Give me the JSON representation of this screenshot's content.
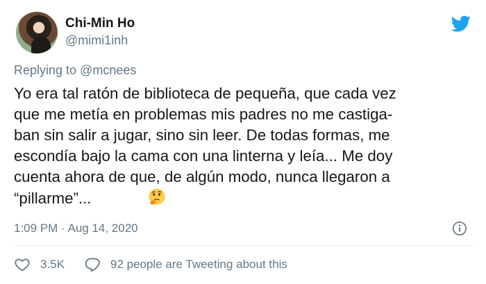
{
  "author": {
    "display_name": "Chi-Min Ho",
    "handle": "@mimi1inh"
  },
  "reply_context": {
    "prefix": "Replying to ",
    "mention": "@mcnees"
  },
  "tweet": {
    "lines": [
      "Yo era tal ratón de biblioteca de pequeña, que cada vez",
      "que me metía en problemas mis padres no me castiga-",
      "ban sin salir a jugar, sino sin leer. De todas formas, me",
      "escondía bajo la cama con una linterna y leía... Me doy",
      "cuenta ahora de que, de algún modo, nunca llegaron a",
      "“pillarme”..."
    ],
    "emoji": "thinking-face-icon"
  },
  "meta": {
    "timestamp": "1:09 PM · Aug 14, 2020"
  },
  "actions": {
    "likes": "3.5K",
    "conversation": "92 people are Tweeting about this"
  },
  "colors": {
    "twitter_blue": "#1da1f2",
    "muted_text": "#657786",
    "main_text": "#14171a"
  }
}
